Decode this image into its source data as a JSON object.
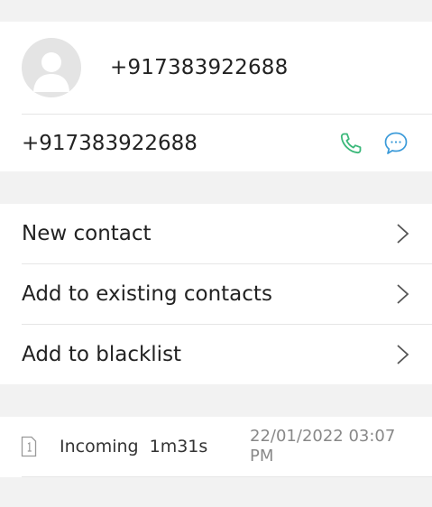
{
  "header": {
    "number": "+917383922688"
  },
  "number_row": {
    "number": "+917383922688",
    "phone_icon": "phone-icon",
    "message_icon": "message-icon",
    "accent_color": "#3bb87a",
    "message_color": "#3a9ad9"
  },
  "menu": {
    "items": [
      {
        "label": "New contact"
      },
      {
        "label": "Add to existing contacts"
      },
      {
        "label": "Add to blacklist"
      }
    ]
  },
  "call_log": {
    "entries": [
      {
        "sim_icon": "sim-1-icon",
        "type": "Incoming",
        "duration": "1m31s",
        "datetime": "22/01/2022 03:07 PM"
      }
    ]
  }
}
